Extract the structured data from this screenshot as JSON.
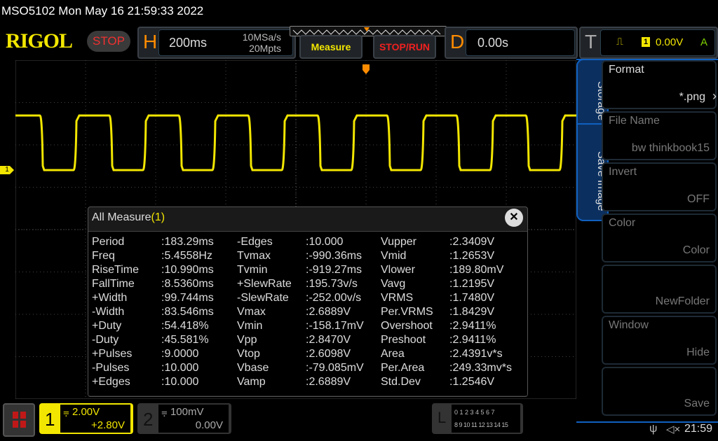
{
  "header": {
    "title": "MSO5102  Mon May 16 21:59:33 2022",
    "logo": "RIGOL",
    "run_state": "STOP"
  },
  "horizontal": {
    "letter": "H",
    "timebase": "200ms",
    "sample_rate": "10MSa/s",
    "memory_depth": "20Mpts"
  },
  "buttons": {
    "measure": "Measure",
    "stop_run": "STOP/RUN"
  },
  "delay": {
    "letter": "D",
    "value": "0.00s"
  },
  "trigger": {
    "letter": "T",
    "edge_icon": "rising-edge-icon",
    "source": "1",
    "level": "0.00V",
    "mode": "A"
  },
  "channel_marker": "1",
  "measure_panel": {
    "title": "All Measure",
    "channel": "(1)",
    "columns": [
      [
        [
          "Period",
          ":183.29ms"
        ],
        [
          "Freq",
          ":5.4558Hz"
        ],
        [
          "RiseTime",
          ":10.990ms"
        ],
        [
          "FallTime",
          ":8.5360ms"
        ],
        [
          "+Width",
          ":99.744ms"
        ],
        [
          "-Width",
          ":83.546ms"
        ],
        [
          "+Duty",
          ":54.418%"
        ],
        [
          "-Duty",
          ":45.581%"
        ],
        [
          "+Pulses",
          ":9.0000"
        ],
        [
          "-Pulses",
          ":10.000"
        ],
        [
          "+Edges",
          ":10.000"
        ]
      ],
      [
        [
          "-Edges",
          ":10.000"
        ],
        [
          "Tvmax",
          ":-990.36ms"
        ],
        [
          "Tvmin",
          ":-919.27ms"
        ],
        [
          "+SlewRate",
          ":195.73v/s"
        ],
        [
          "-SlewRate",
          ":-252.00v/s"
        ],
        [
          "Vmax",
          ":2.6889V"
        ],
        [
          "Vmin",
          ":-158.17mV"
        ],
        [
          "Vpp",
          ":2.8470V"
        ],
        [
          "Vtop",
          ":2.6098V"
        ],
        [
          "Vbase",
          ":-79.085mV"
        ],
        [
          "Vamp",
          ":2.6889V"
        ]
      ],
      [
        [
          "Vupper",
          ":2.3409V"
        ],
        [
          "Vmid",
          ":1.2653V"
        ],
        [
          "Vlower",
          ":189.80mV"
        ],
        [
          "Vavg",
          ":1.2195V"
        ],
        [
          "VRMS",
          ":1.7480V"
        ],
        [
          "Per.VRMS",
          ":1.8429V"
        ],
        [
          "Overshoot",
          ":2.9411%"
        ],
        [
          "Preshoot",
          ":2.9411%"
        ],
        [
          "Area",
          ":2.4391v*s"
        ],
        [
          "Per.Area",
          ":249.33mv*s"
        ],
        [
          "Std.Dev",
          ":1.2546V"
        ]
      ]
    ]
  },
  "menu": {
    "tabs": [
      "Storage",
      "Save Image"
    ],
    "items": [
      {
        "title": "Format",
        "value": "*.png"
      },
      {
        "title": "File Name",
        "value": "bw thinkbook15"
      },
      {
        "title": "Invert",
        "value": "OFF"
      },
      {
        "title": "Color",
        "value": "Color"
      },
      {
        "title": "",
        "value": "NewFolder"
      },
      {
        "title": "Window",
        "value": "Hide"
      },
      {
        "title": "",
        "value": "Save"
      }
    ]
  },
  "ch1": {
    "num": "1",
    "scale": "2.00V",
    "offset": "+2.80V"
  },
  "ch2": {
    "num": "2",
    "scale": "100mV",
    "offset": "0.00V"
  },
  "logic": {
    "letter": "L",
    "row1": "0 1 2 3  4 5 6 7",
    "row2": "8 9 10 11 12 13 14 15"
  },
  "status": {
    "time": "21:59"
  },
  "colors": {
    "ch1": "#f2e600",
    "accent": "#ff8c00",
    "menu_blue": "#1060c0",
    "stop": "#f03030"
  }
}
